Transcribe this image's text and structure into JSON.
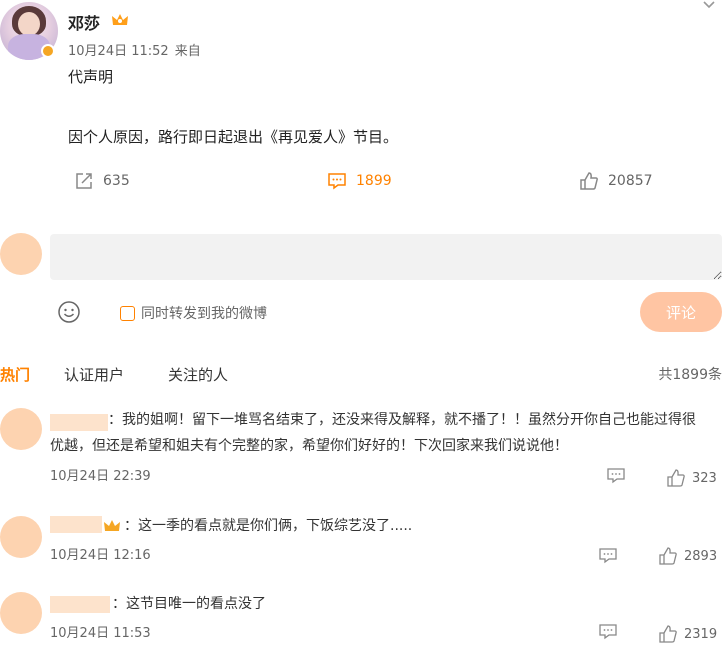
{
  "post": {
    "username": "邓莎",
    "date": "10月24日 11:52",
    "source_label": "来自",
    "line1": "代声明",
    "line2": "因个人原因，路行即日起退出《再见爱人》节目。",
    "shares": "635",
    "comments": "1899",
    "likes": "20857"
  },
  "composer": {
    "placeholder": "",
    "repost_label": "同时转发到我的微博",
    "submit_label": "评论"
  },
  "tabs": {
    "hot": "热门",
    "verified": "认证用户",
    "following": "关注的人",
    "total": "共1899条"
  },
  "comments": [
    {
      "text_line1": "：我的姐啊！留下一堆骂名结束了，还没来得及解释，就不播了！！虽然分开你自己也能过得很",
      "text_line2": "优越，但还是希望和姐夫有个完整的家，希望你们好好的！下次回家来我们说说他！",
      "time": "10月24日 22:39",
      "likes": "323"
    },
    {
      "text_line1": "：这一季的看点就是你们俩，下饭综艺没了.....",
      "time": "10月24日 12:16",
      "likes": "2893"
    },
    {
      "text_line1": "：这节目唯一的看点没了",
      "time": "10月24日 11:53",
      "likes": "2319"
    }
  ],
  "colors": {
    "accent": "#ff8200",
    "button_disabled": "#ffc5a3",
    "input_bg": "#f2f2f2",
    "redaction": "#fde3cc"
  },
  "icons": [
    "chevron-down-icon",
    "crown-icon",
    "share-icon",
    "comment-icon",
    "like-icon",
    "emoji-icon",
    "reply-icon"
  ]
}
